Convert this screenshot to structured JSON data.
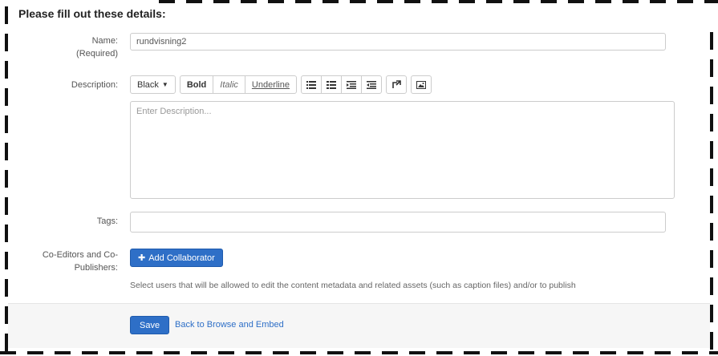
{
  "form": {
    "title": "Please fill out these details:",
    "name": {
      "label": "Name:",
      "sublabel": "(Required)",
      "value": "rundvisning2"
    },
    "description": {
      "label": "Description:",
      "placeholder": "Enter Description...",
      "toolbar": {
        "color": "Black",
        "bold": "Bold",
        "italic": "Italic",
        "underline": "Underline",
        "icons": [
          "unordered-list-icon",
          "ordered-list-icon",
          "outdent-icon",
          "indent-icon",
          "link-icon",
          "image-icon"
        ]
      }
    },
    "tags": {
      "label": "Tags:",
      "value": ""
    },
    "collaborators": {
      "label_line1": "Co-Editors and Co-",
      "label_line2": "Publishers:",
      "button": "Add Collaborator",
      "help": "Select users that will be allowed to edit the content metadata and related assets (such as caption files) and/or to publish"
    }
  },
  "footer": {
    "save": "Save",
    "back": "Back to Browse and Embed"
  },
  "colors": {
    "primary": "#2e6fc7",
    "frame": "#111111"
  }
}
